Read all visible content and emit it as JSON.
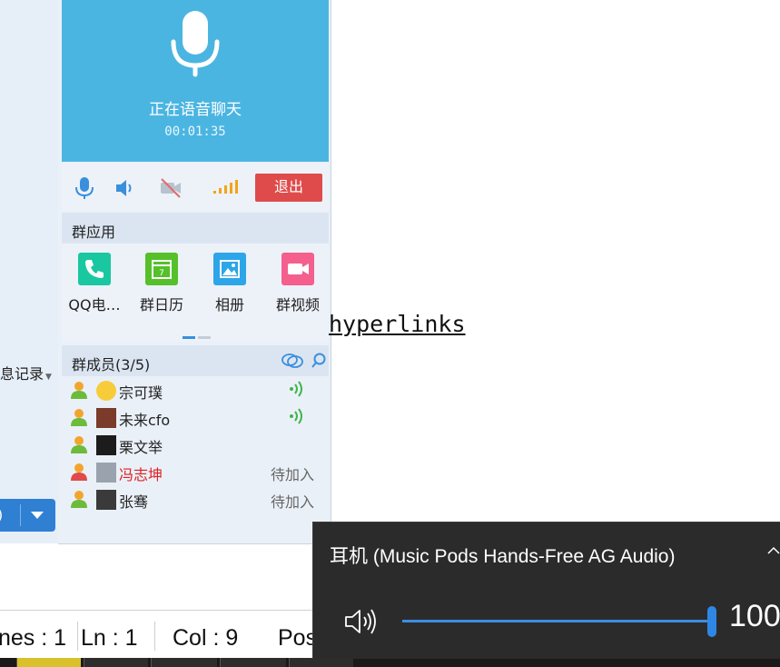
{
  "left_panel": {
    "record_label": "息记录",
    "send_fragment": ")"
  },
  "voice": {
    "status": "正在语音聊天",
    "timer": "00:01:35",
    "exit_label": "退出"
  },
  "group_apps": {
    "title": "群应用",
    "apps": [
      {
        "label": "QQ电…",
        "color": "#19c8a0"
      },
      {
        "label": "群日历",
        "color": "#55c02a"
      },
      {
        "label": "相册",
        "color": "#2ca6e8"
      },
      {
        "label": "群视频",
        "color": "#f45f8e"
      }
    ]
  },
  "members": {
    "title": "群成员(3/5)",
    "list": [
      {
        "name": "宗可璞",
        "status": "",
        "speaking": true,
        "highlight": false
      },
      {
        "name": "未来cfo",
        "status": "",
        "speaking": true,
        "highlight": false
      },
      {
        "name": "栗文举",
        "status": "",
        "speaking": false,
        "highlight": false
      },
      {
        "name": "冯志坤",
        "status": "待加入",
        "speaking": false,
        "highlight": true
      },
      {
        "name": "张骞",
        "status": "待加入",
        "speaking": false,
        "highlight": false
      }
    ]
  },
  "editor": {
    "hyperlink_text": "hyperlinks"
  },
  "status_bar": {
    "lines": "nes : 1",
    "ln": "Ln : 1",
    "col": "Col : 9",
    "pos": "Pos"
  },
  "volume": {
    "device": "耳机 (Music Pods Hands-Free AG Audio)",
    "level": 100,
    "level_text": "100",
    "accent": "#2f87e5"
  },
  "colors": {
    "voice_header": "#4bb5e1",
    "exit_red": "#df4b4b",
    "highlight_red": "#e02020"
  }
}
